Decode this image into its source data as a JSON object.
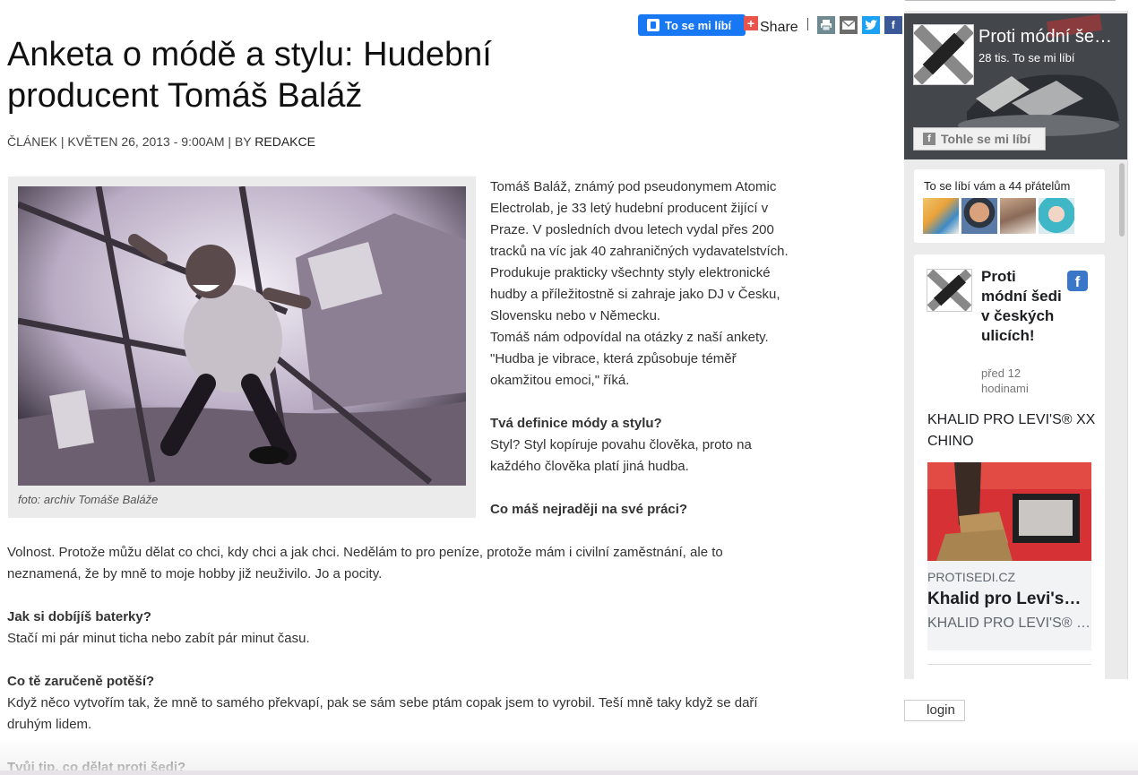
{
  "share": {
    "fb_like_label": "To se mi líbí",
    "share_label": "Share"
  },
  "article": {
    "title": "Anketa o módě a stylu: Hudební producent Tomáš Baláž",
    "meta_prefix": "ČLÁNEK | KVĚTEN 26, 2013 - 9:00AM | BY ",
    "meta_author": "REDAKCE",
    "caption": "foto: archiv Tomáše Baláže",
    "intro": "Tomáš Baláž, známý pod pseudonymem Atomic Electrolab, je 33 letý hudební producent žijící v Praze. V posledních dvou letech vydal přes 200 tracků na víc jak 40 zahraničných vydavatelstvích. Produkuje prakticky všechnty styly elektronické hudby a příležitostně si zahraje jako DJ v Česku, Slovensku nebo v Německu.",
    "intro2": "Tomáš nám odpovídal na otázky z naší ankety. \"Hudba je vibrace, která způsobuje téměř okamžitou emoci,\" říká.",
    "q1": "Tvá definice módy a stylu?",
    "a1": "Styl? Styl kopíruje povahu člověka, proto na každého člověka platí jiná hudba.",
    "q2": "Co máš nejraději na své práci?",
    "a2": "Volnost. Protože můžu dělat co chci, kdy chci a jak chci. Nedělám to pro peníze, protože mám i civilní zaměstnání, ale to neznamená, že by mně to moje hobby již neuživilo. Jo a pocity.",
    "q3": "Jak si dobíjíš baterky?",
    "a3": "Stačí mi pár minut ticha nebo zabít pár minut času.",
    "q4": "Co tě zaručeně potěší?",
    "a4": "Když něco vytvořím tak, že mně to samého překvapí, pak se sám sebe ptám copak jsem to vyrobil. Teší mně taky když se daří druhým lidem.",
    "q5": "Tvůj tip, co dělat proti šedi?"
  },
  "sidebar": {
    "page_name": "Proti módní šedi v českých ulicích!",
    "page_likes": "28 tis. To se mi líbí",
    "like_button": "Tohle se mi líbí",
    "friends_label": "To se líbí vám a 44 přátelům",
    "post_title": "Proti módní šedi v českých ulicích!",
    "post_time": "před 12 hodinami",
    "post_body": "KHALID PRO LEVI'S® XX CHINO",
    "card_domain": "PROTISEDI.CZ",
    "card_title": "Khalid pro Levi's® XX Chino",
    "card_desc": "KHALID PRO LEVI'S® XX CHINO"
  },
  "login_label": "login"
}
